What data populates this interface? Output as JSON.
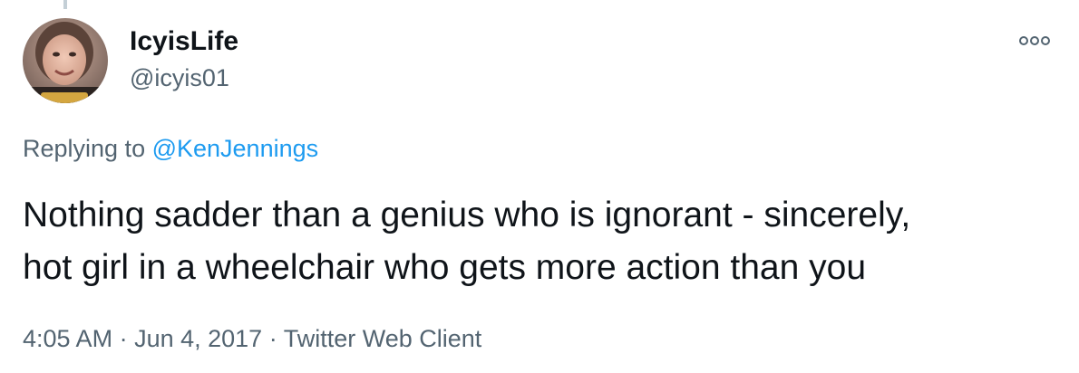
{
  "user": {
    "display_name": "IcyisLife",
    "handle": "@icyis01"
  },
  "reply": {
    "prefix": "Replying to ",
    "mention": "@KenJennings"
  },
  "tweet": {
    "text_line1": "Nothing sadder than a genius who is ignorant - sincerely,",
    "text_line2": "hot girl in a wheelchair who gets more action than you"
  },
  "meta": {
    "time": "4:05 AM",
    "separator": " · ",
    "date": "Jun 4, 2017",
    "source": "Twitter Web Client"
  },
  "icons": {
    "more": "more-options-icon"
  },
  "colors": {
    "text": "#0f1419",
    "secondary": "#536471",
    "link": "#1d9bf0"
  }
}
